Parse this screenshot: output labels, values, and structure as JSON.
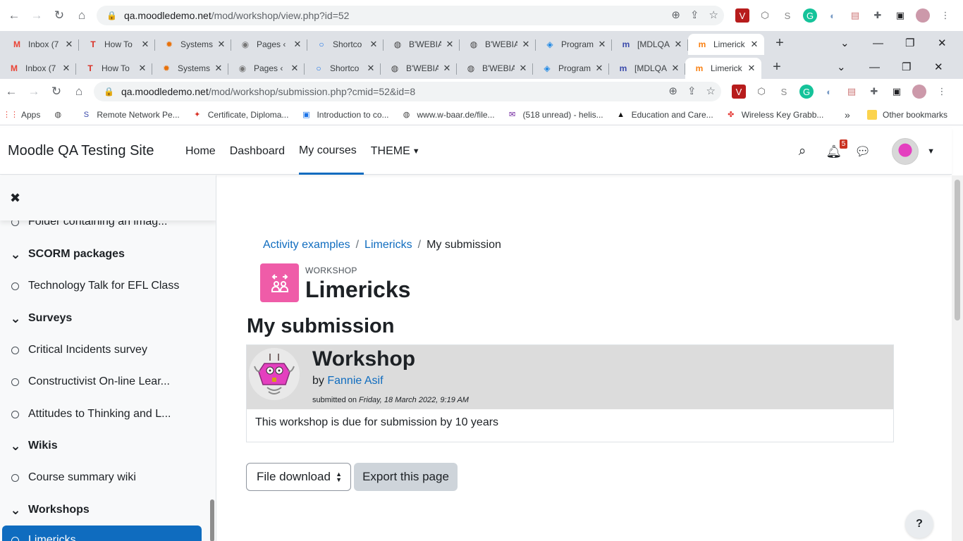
{
  "browser_back": {
    "url_host": "qa.moodledemo.net",
    "url_path": "/mod/workshop/view.php?id=52",
    "tabs": [
      {
        "title": "Inbox (7",
        "icon": "M",
        "color": "#ea4335"
      },
      {
        "title": "How To",
        "icon": "T",
        "color": "#d93025"
      },
      {
        "title": "Systems",
        "icon": "✹",
        "color": "#e8710a"
      },
      {
        "title": "Pages ‹",
        "icon": "◉",
        "color": "#777"
      },
      {
        "title": "Shortco",
        "icon": "○",
        "color": "#1a73e8"
      },
      {
        "title": "B'WEBIA",
        "icon": "◍",
        "color": "#444"
      },
      {
        "title": "B'WEBIA",
        "icon": "◍",
        "color": "#444"
      },
      {
        "title": "Program",
        "icon": "◈",
        "color": "#1e88e5"
      },
      {
        "title": "[MDLQA",
        "icon": "m",
        "color": "#3949ab"
      },
      {
        "title": "Limerick",
        "icon": "m",
        "color": "#f98012"
      }
    ]
  },
  "browser": {
    "url_host": "qa.moodledemo.net",
    "url_path": "/mod/workshop/submission.php?cmid=52&id=8",
    "tabs": [
      {
        "title": "Inbox (7",
        "icon": "M",
        "color": "#ea4335"
      },
      {
        "title": "How To",
        "icon": "T",
        "color": "#d93025"
      },
      {
        "title": "Systems",
        "icon": "✹",
        "color": "#e8710a"
      },
      {
        "title": "Pages ‹",
        "icon": "◉",
        "color": "#777"
      },
      {
        "title": "Shortco",
        "icon": "○",
        "color": "#1a73e8"
      },
      {
        "title": "B'WEBIA",
        "icon": "◍",
        "color": "#444"
      },
      {
        "title": "B'WEBIA",
        "icon": "◍",
        "color": "#444"
      },
      {
        "title": "Program",
        "icon": "◈",
        "color": "#1e88e5"
      },
      {
        "title": "[MDLQA",
        "icon": "m",
        "color": "#3949ab"
      },
      {
        "title": "Limerick",
        "icon": "m",
        "color": "#f98012"
      }
    ],
    "bookmarks": [
      {
        "label": "Apps",
        "icon": "⋮⋮",
        "color": "#ea4335"
      },
      {
        "label": "",
        "icon": "◍",
        "color": "#444"
      },
      {
        "label": "Remote Network Pe...",
        "icon": "S",
        "color": "#3949ab"
      },
      {
        "label": "Certificate, Diploma...",
        "icon": "✦",
        "color": "#d93025"
      },
      {
        "label": "Introduction to co...",
        "icon": "▣",
        "color": "#1a73e8"
      },
      {
        "label": "www.w-baar.de/file...",
        "icon": "◍",
        "color": "#444"
      },
      {
        "label": "(518 unread) - helis...",
        "icon": "✉",
        "color": "#6a1b9a"
      },
      {
        "label": "Education and Care...",
        "icon": "▲",
        "color": "#111"
      },
      {
        "label": "Wireless Key Grabb...",
        "icon": "✤",
        "color": "#e53935"
      }
    ],
    "bookmarks_more": "»",
    "other_bookmarks": "Other bookmarks"
  },
  "moodle": {
    "site_name": "Moodle QA Testing Site",
    "nav": [
      "Home",
      "Dashboard",
      "My courses",
      "THEME"
    ],
    "notification_count": "5"
  },
  "drawer": {
    "items": [
      {
        "label": "Folder containing an imag...",
        "kind": "item"
      },
      {
        "label": "SCORM packages",
        "kind": "section"
      },
      {
        "label": "Technology Talk for EFL Class",
        "kind": "item"
      },
      {
        "label": "Surveys",
        "kind": "section"
      },
      {
        "label": "Critical Incidents survey",
        "kind": "item"
      },
      {
        "label": "Constructivist On-line Lear...",
        "kind": "item"
      },
      {
        "label": "Attitudes to Thinking and L...",
        "kind": "item"
      },
      {
        "label": "Wikis",
        "kind": "section"
      },
      {
        "label": "Course summary wiki",
        "kind": "item"
      },
      {
        "label": "Workshops",
        "kind": "section"
      },
      {
        "label": "Limericks",
        "kind": "selected"
      }
    ]
  },
  "breadcrumb": {
    "items": [
      "Activity examples",
      "Limericks"
    ],
    "current": "My submission",
    "separator": "/"
  },
  "activity": {
    "type_label": "WORKSHOP",
    "title": "Limericks"
  },
  "submission": {
    "heading": "My submission",
    "title": "Workshop",
    "by_prefix": "by",
    "author": "Fannie Asif",
    "submitted_prefix": "submitted on",
    "submitted_date": "Friday, 18 March 2022, 9:19 AM",
    "content": "This workshop is due for submission by 10 years"
  },
  "actions": {
    "download_select": "File download",
    "export_button": "Export this page"
  },
  "help_button": "?"
}
